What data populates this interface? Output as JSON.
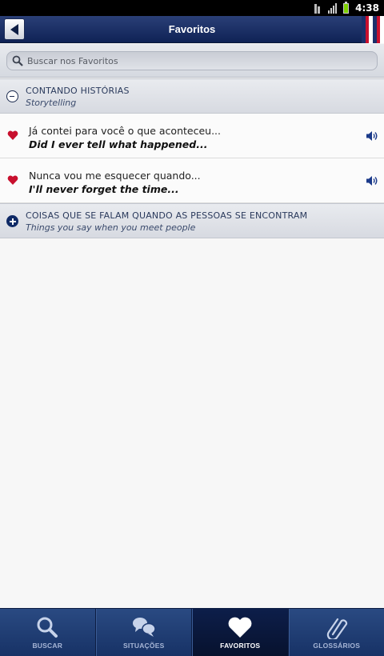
{
  "status_bar": {
    "time": "4:38"
  },
  "header": {
    "title": "Favoritos",
    "back_icon": "back-arrow-icon"
  },
  "search": {
    "placeholder": "Buscar nos Favoritos"
  },
  "sections": [
    {
      "title": "CONTANDO HISTÓRIAS",
      "subtitle": "Storytelling",
      "state": "expanded",
      "items": [
        {
          "pt": "Já contei para você o que aconteceu...",
          "en": "Did I ever tell what happened..."
        },
        {
          "pt": "Nunca vou me esquecer quando...",
          "en": "I'll never forget the time..."
        }
      ]
    },
    {
      "title": "COISAS QUE SE FALAM QUANDO AS PESSOAS SE ENCONTRAM",
      "subtitle": "Things you say when you meet people",
      "state": "collapsed"
    }
  ],
  "tabs": [
    {
      "label": "BUSCAR",
      "icon": "search-icon"
    },
    {
      "label": "SITUAÇÕES",
      "icon": "speech-bubbles-icon"
    },
    {
      "label": "FAVORITOS",
      "icon": "heart-icon",
      "active": true
    },
    {
      "label": "GLOSSÁRIOS",
      "icon": "paperclip-icon"
    }
  ],
  "colors": {
    "header": "#1a2f66",
    "heart": "#c8102e",
    "tab_active": "#0a1840",
    "flag_red": "#c8102e"
  }
}
